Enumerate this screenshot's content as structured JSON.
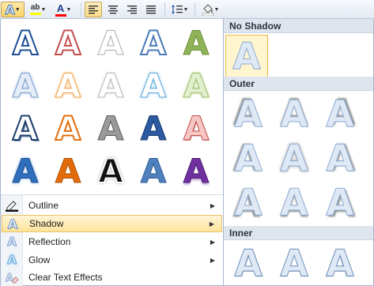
{
  "menu": {
    "outline": "Outline",
    "shadow": "Shadow",
    "reflection": "Reflection",
    "glow": "Glow",
    "clear": "Clear Text Effects"
  },
  "gallery": {
    "letter": "A"
  },
  "shadow_panel": {
    "no_shadow_title": "No Shadow",
    "outer_title": "Outer",
    "inner_title": "Inner",
    "letter": "A"
  },
  "icons": {
    "text_effects": "text-effects-icon",
    "highlight": "highlight-icon",
    "font_color": "font-color-icon",
    "align_left": "align-left-icon",
    "align_center": "align-center-icon",
    "align_right": "align-right-icon",
    "justify": "justify-icon",
    "line_spacing": "line-spacing-icon",
    "shading": "shading-icon"
  },
  "colors": {
    "accent_selected": "#fbd56a",
    "highlight_yellow": "#ffff00",
    "font_red": "#ff0000"
  },
  "toolbar": {
    "highlight_letters": "ab",
    "font_color_letter": "A"
  }
}
